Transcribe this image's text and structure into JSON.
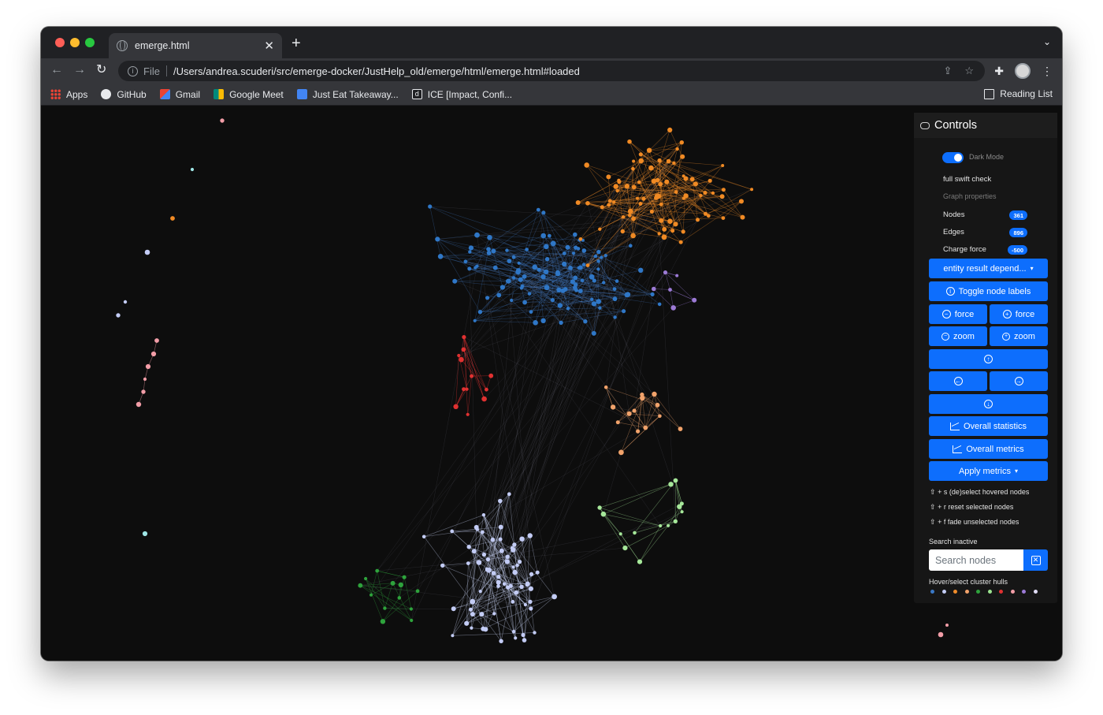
{
  "browser": {
    "tab_title": "emerge.html",
    "tab_close": "✕",
    "new_tab": "+",
    "scheme": "File",
    "url": "/Users/andrea.scuderi/src/emerge-docker/JustHelp_old/emerge/html/emerge.html#loaded",
    "bookmarks": [
      {
        "label": "Apps",
        "icon": "apps-grid-icon"
      },
      {
        "label": "GitHub",
        "icon": "github-icon"
      },
      {
        "label": "Gmail",
        "icon": "gmail-icon"
      },
      {
        "label": "Google Meet",
        "icon": "google-meet-icon"
      },
      {
        "label": "Just Eat Takeaway...",
        "icon": "just-eat-icon"
      },
      {
        "label": "ICE [Impact, Confi...",
        "icon": "ice-icon"
      }
    ],
    "reading_list": "Reading List"
  },
  "controls": {
    "title": "Controls",
    "dark_mode_label": "Dark Mode",
    "dark_mode_on": true,
    "full_swift_check": "full swift check",
    "graph_properties": "Graph properties",
    "nodes_label": "Nodes",
    "nodes_value": "361",
    "edges_label": "Edges",
    "edges_value": "896",
    "charge_label": "Charge force",
    "charge_value": "-500",
    "dropdown_label": "entity result depend...",
    "toggle_labels": "Toggle node labels",
    "force_minus": "force",
    "force_plus": "force",
    "zoom_out": "zoom",
    "zoom_in": "zoom",
    "overall_statistics": "Overall statistics",
    "overall_metrics": "Overall metrics",
    "apply_metrics": "Apply metrics",
    "hint_select": "+ s (de)select hovered nodes",
    "hint_reset": "+ r reset selected nodes",
    "hint_fade": "+ f fade unselected nodes",
    "search_status": "Search inactive",
    "search_placeholder": "Search nodes",
    "hulls_label": "Hover/select cluster hulls",
    "hull_colors": [
      "#3a78c6",
      "#c3ccf5",
      "#f08c2a",
      "#f2a36b",
      "#2ea33c",
      "#9be38f",
      "#e03131",
      "#f29da7",
      "#9c7ad6",
      "#e0dcf5"
    ]
  },
  "graph": {
    "cluster_colors": {
      "blue": "#2f77c7",
      "orange": "#f08a24",
      "lavender": "#c3ccf5",
      "green": "#2ea33c",
      "lightgreen": "#a6e89a",
      "red": "#e03131",
      "salmon": "#f2a36b",
      "pink": "#f29da7",
      "purple": "#9c7ad6",
      "cyan": "#9fe6e6"
    }
  }
}
